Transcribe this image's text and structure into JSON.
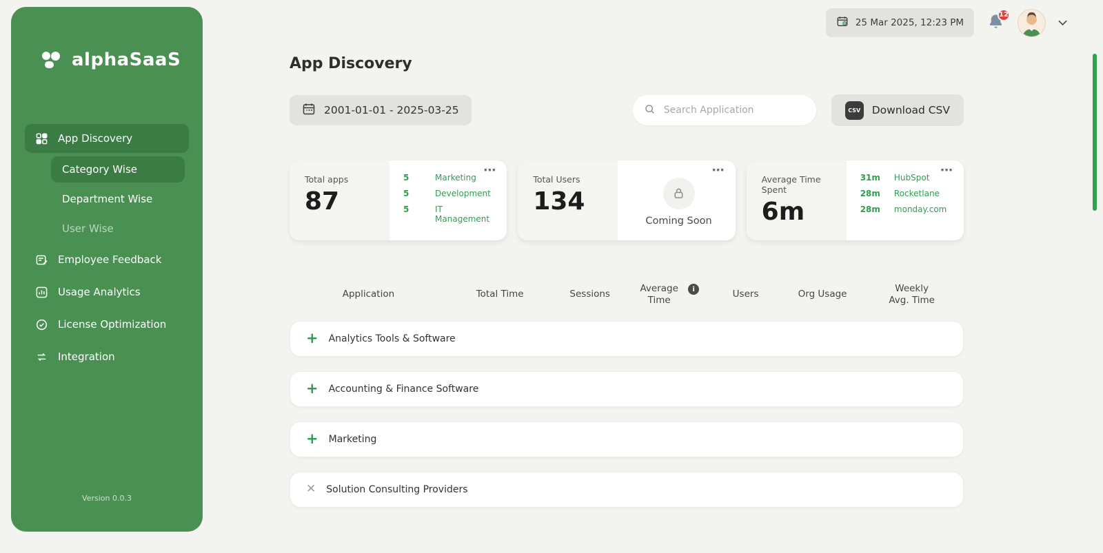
{
  "sidebar": {
    "logo": "alphaSaaS",
    "version": "Version 0.0.3",
    "items": [
      {
        "label": "App Discovery"
      },
      {
        "label": "Category Wise"
      },
      {
        "label": "Department Wise"
      },
      {
        "label": "User Wise"
      },
      {
        "label": "Employee Feedback"
      },
      {
        "label": "Usage Analytics"
      },
      {
        "label": "License Optimization"
      },
      {
        "label": "Integration"
      }
    ]
  },
  "topbar": {
    "datetime": "25 Mar 2025, 12:23 PM",
    "notification_count": "12"
  },
  "page": {
    "title": "App Discovery"
  },
  "controls": {
    "date_range": "2001-01-01 - 2025-03-25",
    "search_placeholder": "Search Application",
    "download_csv": "Download CSV",
    "csv_badge": "CSV"
  },
  "stats": {
    "total_apps": {
      "label": "Total apps",
      "value": "87",
      "breakdown": [
        {
          "count": "5",
          "name": "Marketing"
        },
        {
          "count": "5",
          "name": "Development"
        },
        {
          "count": "5",
          "name": "IT Management"
        }
      ]
    },
    "total_users": {
      "label": "Total Users",
      "value": "134",
      "status": "Coming Soon"
    },
    "avg_time": {
      "label": "Average Time Spent",
      "value": "6m",
      "breakdown": [
        {
          "count": "31m",
          "name": "HubSpot"
        },
        {
          "count": "28m",
          "name": "Rocketlane"
        },
        {
          "count": "28m",
          "name": "monday.com"
        }
      ]
    }
  },
  "table": {
    "headers": {
      "application": "Application",
      "total_time": "Total Time",
      "sessions": "Sessions",
      "average_time": "Average Time",
      "users": "Users",
      "org_usage": "Org Usage",
      "weekly_avg": "Weekly Avg. Time"
    },
    "rows": [
      {
        "name": "Analytics Tools & Software"
      },
      {
        "name": "Accounting & Finance Software"
      },
      {
        "name": "Marketing"
      },
      {
        "name": "Solution Consulting Providers"
      }
    ]
  },
  "icons": {
    "plus": "+",
    "close": "✕",
    "dots": "⋯",
    "info": "i"
  },
  "colors": {
    "sidebar_green": "#4a9052",
    "active_green": "#3a7c43",
    "accent_green": "#2f9e51",
    "badge_red": "#d9453e"
  }
}
